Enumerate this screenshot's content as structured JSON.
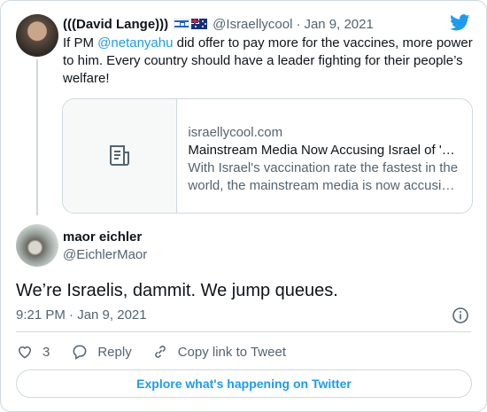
{
  "parent_tweet": {
    "display_name": "(((David Lange)))",
    "flags": [
      "israel-flag",
      "australia-flag"
    ],
    "handle": "@Israellycool",
    "separator": "·",
    "date": "Jan 9, 2021",
    "text_before": "If PM ",
    "mention": "@netanyahu",
    "text_after": " did offer to pay more for the vaccines, more power to him. Every country should have a leader fighting for their people’s welfare!",
    "link_card": {
      "domain": "israellycool.com",
      "title": "Mainstream Media Now Accusing Israel of '…",
      "description_line1": "With Israel's vaccination rate the fastest in the",
      "description_line2": "world, the mainstream media is now accusi…",
      "thumb_icon": "article-icon"
    }
  },
  "main_tweet": {
    "display_name": "maor eichler",
    "handle": "@EichlerMaor",
    "text": "We’re Israelis, dammit. We jump queues.",
    "timestamp": "9:21 PM · Jan 9, 2021",
    "actions": {
      "like_count": "3",
      "reply_label": "Reply",
      "copy_label": "Copy link to Tweet"
    },
    "explore_label": "Explore what's happening on Twitter"
  },
  "colors": {
    "accent": "#1d9bf0",
    "text_primary": "#0f1419",
    "text_secondary": "#536471",
    "border": "#cfd9de"
  },
  "icons": [
    "twitter-bird-icon",
    "info-icon",
    "heart-icon",
    "reply-icon",
    "link-icon",
    "article-icon"
  ]
}
